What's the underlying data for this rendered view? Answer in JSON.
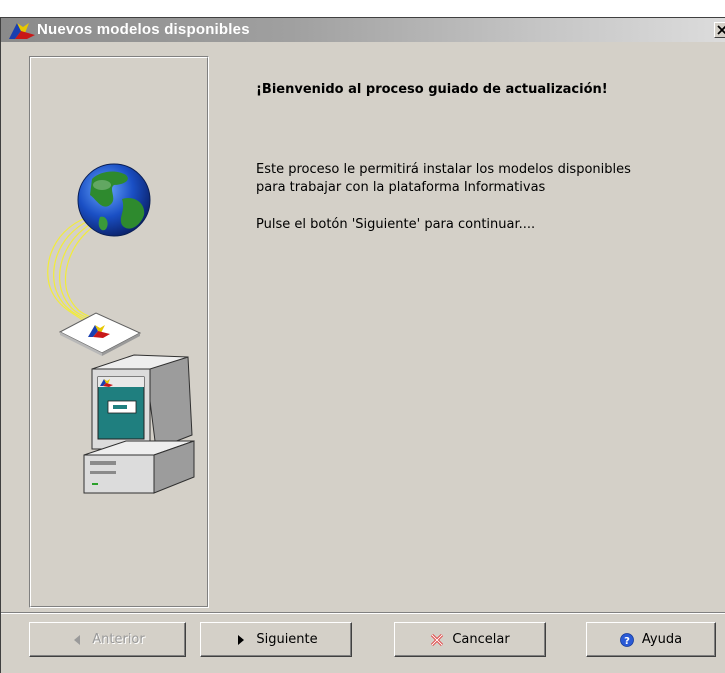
{
  "window": {
    "title": "Nuevos modelos disponibles"
  },
  "content": {
    "heading": "¡Bienvenido al proceso guiado de actualización!",
    "line1": "Este proceso le permitirá instalar los modelos disponibles",
    "line2": "para trabajar con la plataforma Informativas",
    "line3": "Pulse el botón 'Siguiente' para continuar...."
  },
  "buttons": {
    "anterior": {
      "label": "Anterior",
      "enabled": false,
      "icon": "arrow-left-icon"
    },
    "siguiente": {
      "label": "Siguiente",
      "enabled": true,
      "icon": "arrow-right-icon"
    },
    "cancelar": {
      "label": "Cancelar",
      "enabled": true,
      "icon": "cancel-x-icon"
    },
    "ayuda": {
      "label": "Ayuda",
      "enabled": true,
      "icon": "help-icon"
    }
  },
  "colors": {
    "dialog_bg": "#d4d0c8",
    "title_gradient_start": "#8a8a8a",
    "title_gradient_end": "#dcdcdc"
  }
}
